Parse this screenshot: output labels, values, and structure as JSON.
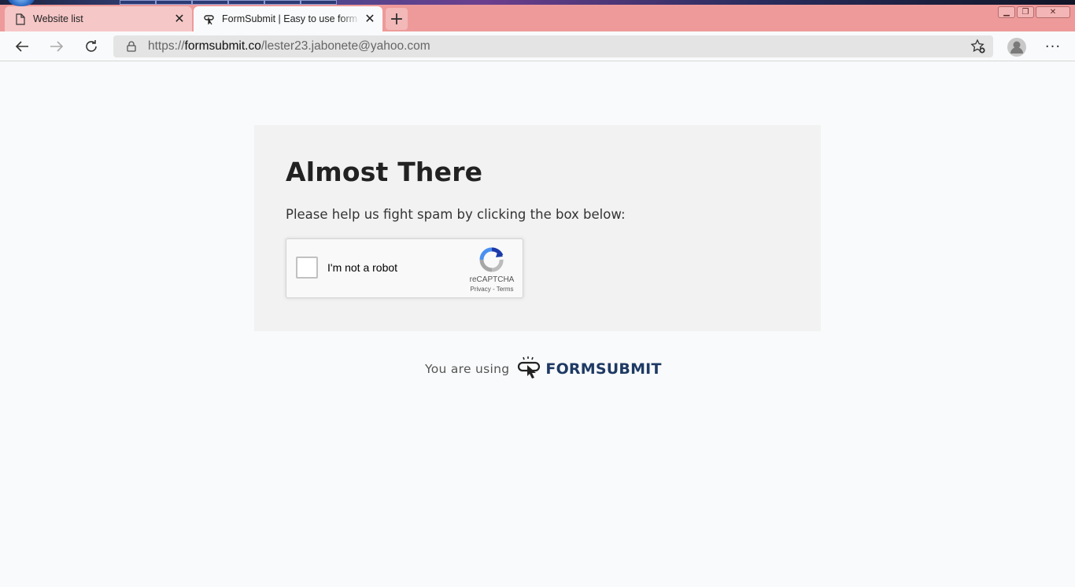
{
  "browser": {
    "tabs": [
      {
        "title": "Website list",
        "icon": "page-icon",
        "active": false
      },
      {
        "title": "FormSubmit | Easy to use form backend",
        "icon": "formsubmit-favicon",
        "active": true
      }
    ],
    "new_tab_label": "+",
    "address": {
      "scheme": "https://",
      "host": "formsubmit.co",
      "path": "/lester23.jabonete@yahoo.com"
    }
  },
  "page": {
    "heading": "Almost There",
    "lead": "Please help us fight spam by clicking the box below:",
    "recaptcha": {
      "checkbox_label": "I'm not a robot",
      "brand": "reCAPTCHA",
      "privacy": "Privacy",
      "separator": " - ",
      "terms": "Terms"
    },
    "footer": {
      "prefix": "You are using",
      "brand": "FORMSUBMIT"
    }
  },
  "colors": {
    "tab_strip": "#ee9a9a",
    "page_bg": "#f9fafb",
    "card_bg": "#f2f2f2",
    "brand_navy": "#1e3a64"
  }
}
